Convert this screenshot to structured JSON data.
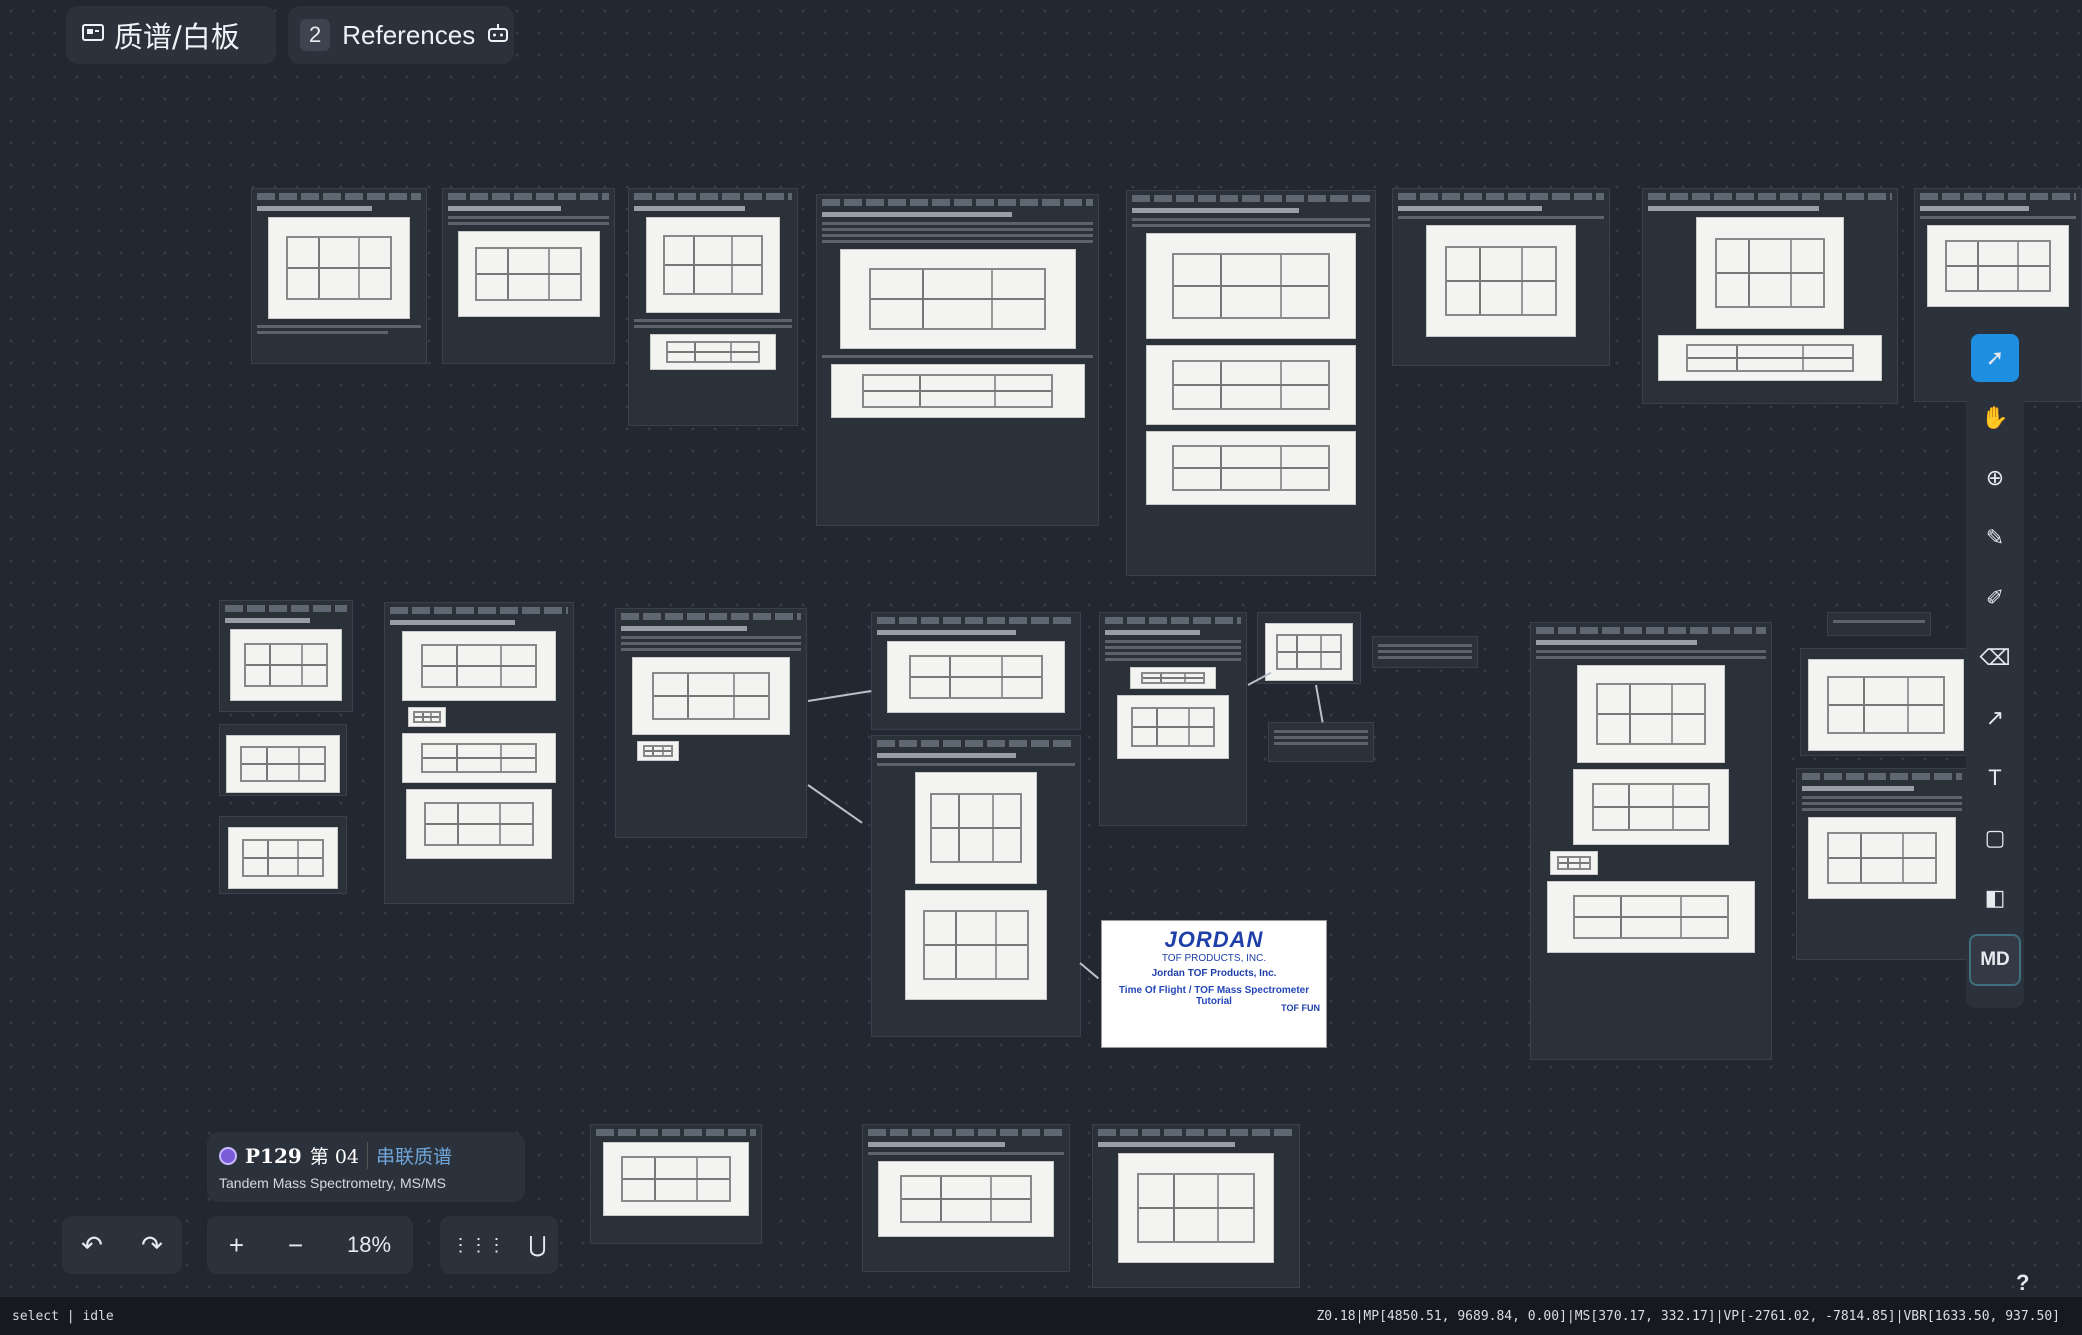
{
  "app": {
    "title": "质谱/白板",
    "title_icon": "board-icon",
    "refs_count": "2",
    "refs_label": "References",
    "refs_icon": "robot-icon"
  },
  "toolbar": {
    "tools": [
      {
        "name": "select-tool",
        "glyph": "➚",
        "active": true
      },
      {
        "name": "hand-tool",
        "glyph": "✋"
      },
      {
        "name": "add-tool",
        "glyph": "⊕"
      },
      {
        "name": "pen-tool",
        "glyph": "✎"
      },
      {
        "name": "highlighter-tool",
        "glyph": "✐"
      },
      {
        "name": "eraser-tool",
        "glyph": "⌫"
      },
      {
        "name": "arrow-tool",
        "glyph": "↗"
      },
      {
        "name": "text-tool",
        "glyph": "T"
      },
      {
        "name": "rectangle-tool",
        "glyph": "▢"
      },
      {
        "name": "frame-tool",
        "glyph": "◧"
      },
      {
        "name": "markdown-tool",
        "glyph": "MD"
      }
    ]
  },
  "info": {
    "page": "P129",
    "chapter": "第 04",
    "topic": "串联质谱",
    "subtitle": "Tandem Mass Spectrometry, MS/MS"
  },
  "controls": {
    "undo": "↶",
    "redo": "↷",
    "zoom_in": "+",
    "zoom_out": "−",
    "zoom": "18%",
    "grid": "⋮⋮⋮",
    "magnet": "⋃"
  },
  "jordan_card": {
    "logo": "JORDAN",
    "company_line": "TOF PRODUCTS, INC.",
    "company": "Jordan TOF Products, Inc.",
    "tutorial": "Time Of Flight / TOF Mass Spectrometer Tutorial",
    "tof_fun": "TOF FUN"
  },
  "status": {
    "mode": "select | idle",
    "metrics": "Z0.18|MP[4850.51, 9689.84, 0.00]|MS[370.17, 332.17]|VP[-2761.02, -7814.85]|VBR[1633.50, 937.50]"
  },
  "help": "?",
  "colors": {
    "accent": "#1e8fe0",
    "background": "#222831",
    "panel": "#2c323c",
    "topic": "#6fa5d9"
  }
}
